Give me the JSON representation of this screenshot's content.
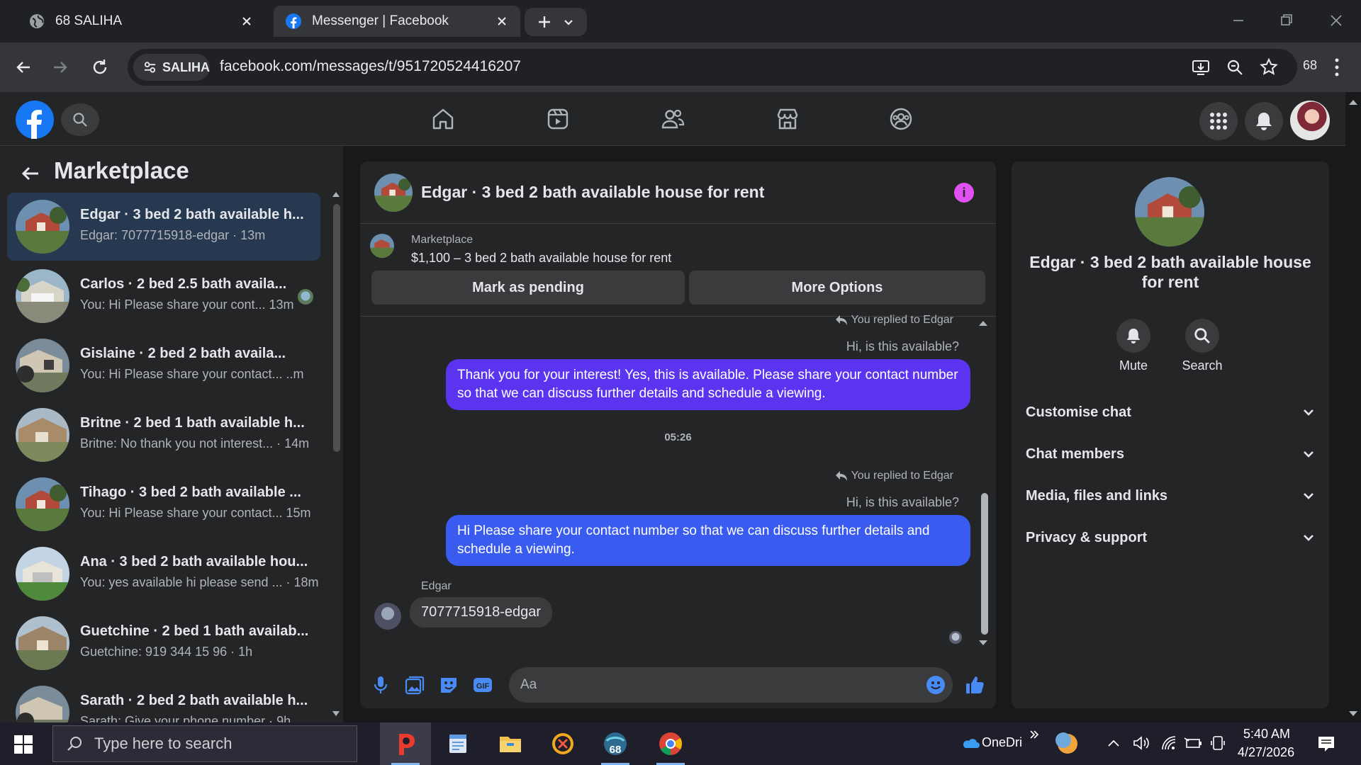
{
  "browser": {
    "tabs": [
      {
        "title": "68 SALIHA"
      },
      {
        "title": "Messenger | Facebook"
      }
    ],
    "address": {
      "chip": "SALIHA",
      "url": "facebook.com/messages/t/951720524416207"
    },
    "profile_count": "68"
  },
  "sidebar": {
    "title": "Marketplace",
    "conversations": [
      {
        "name": "Edgar · 3 bed 2 bath available h...",
        "preview": "Edgar: 7077715918-edgar · 13m"
      },
      {
        "name": "Carlos · 2 bed 2.5 bath availa...",
        "preview": "You: Hi Please share your cont... 13m"
      },
      {
        "name": "Gislaine · 2 bed 2 bath availa...",
        "preview": "You: Hi Please share your contact... ..m"
      },
      {
        "name": "Britne · 2 bed 1 bath available h...",
        "preview": "Britne: No thank you not interest... · 14m"
      },
      {
        "name": "Tihago · 3 bed 2 bath available ...",
        "preview": "You: Hi Please share your contact... 15m"
      },
      {
        "name": "Ana · 3 bed 2 bath available hou...",
        "preview": "You: yes available hi please send ... · 18m"
      },
      {
        "name": "Guetchine · 2 bed 1 bath availab...",
        "preview": "Guetchine: 919 344 15 96 · 1h"
      },
      {
        "name": "Sarath · 2 bed 2 bath available h...",
        "preview": "Sarath: Give your phone number · 9h"
      }
    ]
  },
  "chat": {
    "title": "Edgar · 3 bed 2 bath available house for rent",
    "listing_label": "Marketplace",
    "listing_price": "$1,100 – 3 bed 2 bath available house for rent",
    "mark_pending": "Mark as pending",
    "more_options": "More Options",
    "reply_note": "You replied to Edgar",
    "quoted": "Hi, is this available?",
    "msg1": "Thank you for your interest! Yes, this is available. Please share your contact number so that we can discuss further details and schedule a viewing.",
    "time": "05:26",
    "msg2": "Hi Please share your contact number so that we can discuss further details and schedule a viewing.",
    "incoming_sender": "Edgar",
    "incoming_msg": "7077715918-edgar",
    "composer_placeholder": "Aa"
  },
  "info_panel": {
    "title": "Edgar · 3 bed 2 bath available house for rent",
    "mute": "Mute",
    "search": "Search",
    "sections": [
      "Customise chat",
      "Chat members",
      "Media, files and links",
      "Privacy & support"
    ]
  },
  "taskbar": {
    "search_placeholder": "Type here to search",
    "onedrive": "OneDri",
    "time": "5:40 AM",
    "date": "4/27/2026",
    "app_badge": "68"
  },
  "colors": {
    "accent_purple": "#5b34f0",
    "accent_blue": "#3a5bf0",
    "fb_blue": "#1877f2"
  }
}
